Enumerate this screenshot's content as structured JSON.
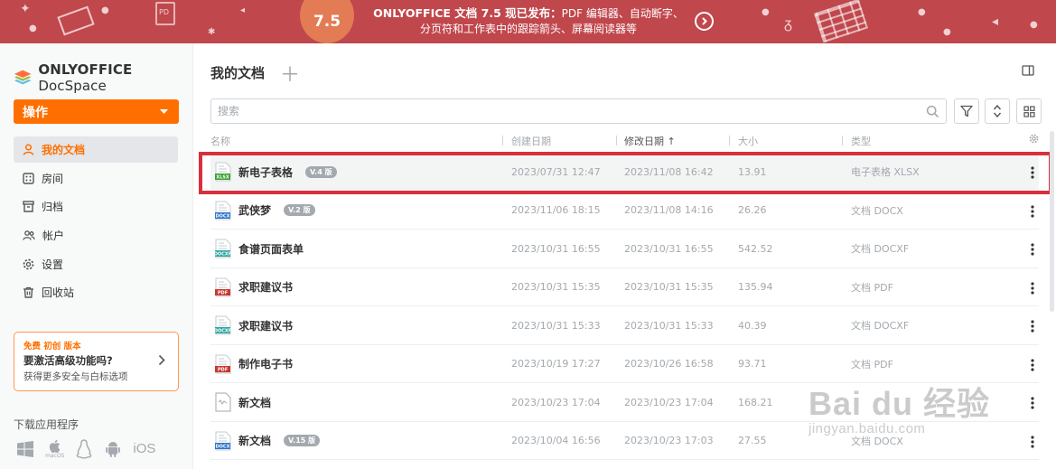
{
  "banner": {
    "version": "7.5",
    "headline": "ONLYOFFICE 文档 7.5 现已发布：",
    "line1_rest": "PDF 编辑器、自动断字、",
    "line2": "分页符和工作表中的跟踪箭头、屏幕阅读器等",
    "color": "#c0474c"
  },
  "sidebar": {
    "logo_brand": "ONLYOFFICE",
    "logo_product": " DocSpace",
    "action_label": "操作",
    "items": [
      {
        "label": "我的文档",
        "icon": "user-icon",
        "active": true
      },
      {
        "label": "房间",
        "icon": "rooms-icon",
        "active": false
      },
      {
        "label": "归档",
        "icon": "archive-icon",
        "active": false
      },
      {
        "label": "帐户",
        "icon": "accounts-icon",
        "active": false
      },
      {
        "label": "设置",
        "icon": "gear-icon",
        "active": false
      },
      {
        "label": "回收站",
        "icon": "trash-icon",
        "active": false
      }
    ],
    "promo": {
      "tag": "免费 初创 版本",
      "title": "要激活高级功能吗?",
      "subtitle": "获得更多安全与白标选项"
    },
    "download_title": "下载应用程序",
    "download_apps": [
      "windows-icon",
      "macos-icon",
      "linux-icon",
      "android-icon",
      "iOS"
    ],
    "macos_label": "macOS",
    "ios_label": "iOS"
  },
  "main": {
    "title": "我的文档",
    "search_placeholder": "搜索",
    "columns": {
      "name": "名称",
      "created": "创建日期",
      "modified": "修改日期",
      "size": "大小",
      "type": "类型"
    },
    "files": [
      {
        "name": "新电子表格",
        "badge": "V.4 版",
        "created": "2023/07/31 12:47",
        "modified": "2023/11/08 16:42",
        "size": "13.91",
        "type": "电子表格 XLSX",
        "icon": "xlsx-file-icon",
        "icon_color": "#3aa133",
        "icon_label": "XLSX"
      },
      {
        "name": "武侠梦",
        "badge": "V.2 版",
        "created": "2023/11/06 18:15",
        "modified": "2023/11/08 14:16",
        "size": "26.26",
        "type": "文档 DOCX",
        "icon": "docx-file-icon",
        "icon_color": "#2b74c9",
        "icon_label": "DOCX"
      },
      {
        "name": "食谱页面表单",
        "badge": "",
        "created": "2023/10/31 16:55",
        "modified": "2023/10/31 16:55",
        "size": "542.52",
        "type": "文档 DOCXF",
        "icon": "docxf-file-icon",
        "icon_color": "#2ba5a0",
        "icon_label": "DOCXF"
      },
      {
        "name": "求职建议书",
        "badge": "",
        "created": "2023/10/31 15:35",
        "modified": "2023/10/31 15:35",
        "size": "135.94",
        "type": "文档 PDF",
        "icon": "pdf-file-icon",
        "icon_color": "#c8382f",
        "icon_label": "PDF"
      },
      {
        "name": "求职建议书",
        "badge": "",
        "created": "2023/10/31 15:33",
        "modified": "2023/10/31 15:33",
        "size": "40.39",
        "type": "文档 DOCXF",
        "icon": "docxf-file-icon",
        "icon_color": "#2ba5a0",
        "icon_label": "DOCXF"
      },
      {
        "name": "制作电子书",
        "badge": "",
        "created": "2023/10/19 17:27",
        "modified": "2023/10/26 16:58",
        "size": "93.71",
        "type": "文档 PDF",
        "icon": "pdf-file-icon",
        "icon_color": "#c8382f",
        "icon_label": "PDF"
      },
      {
        "name": "新文档",
        "badge": "",
        "created": "2023/10/23 17:04",
        "modified": "2023/10/23 17:04",
        "size": "168.21",
        "type": "",
        "icon": "generic-file-icon",
        "icon_color": "#a3a9ae",
        "icon_label": ""
      },
      {
        "name": "新文档",
        "badge": "V.15 版",
        "created": "2023/10/04 16:56",
        "modified": "2023/10/23 17:03",
        "size": "27.55",
        "type": "文档 DOCX",
        "icon": "docx-file-icon",
        "icon_color": "#2b74c9",
        "icon_label": "DOCX"
      }
    ]
  },
  "watermark": {
    "big": "Bai du 经验",
    "small": "jingyan.baidu.com"
  },
  "colors": {
    "accent": "#ff6f00",
    "highlight_frame": "#d8303d"
  }
}
